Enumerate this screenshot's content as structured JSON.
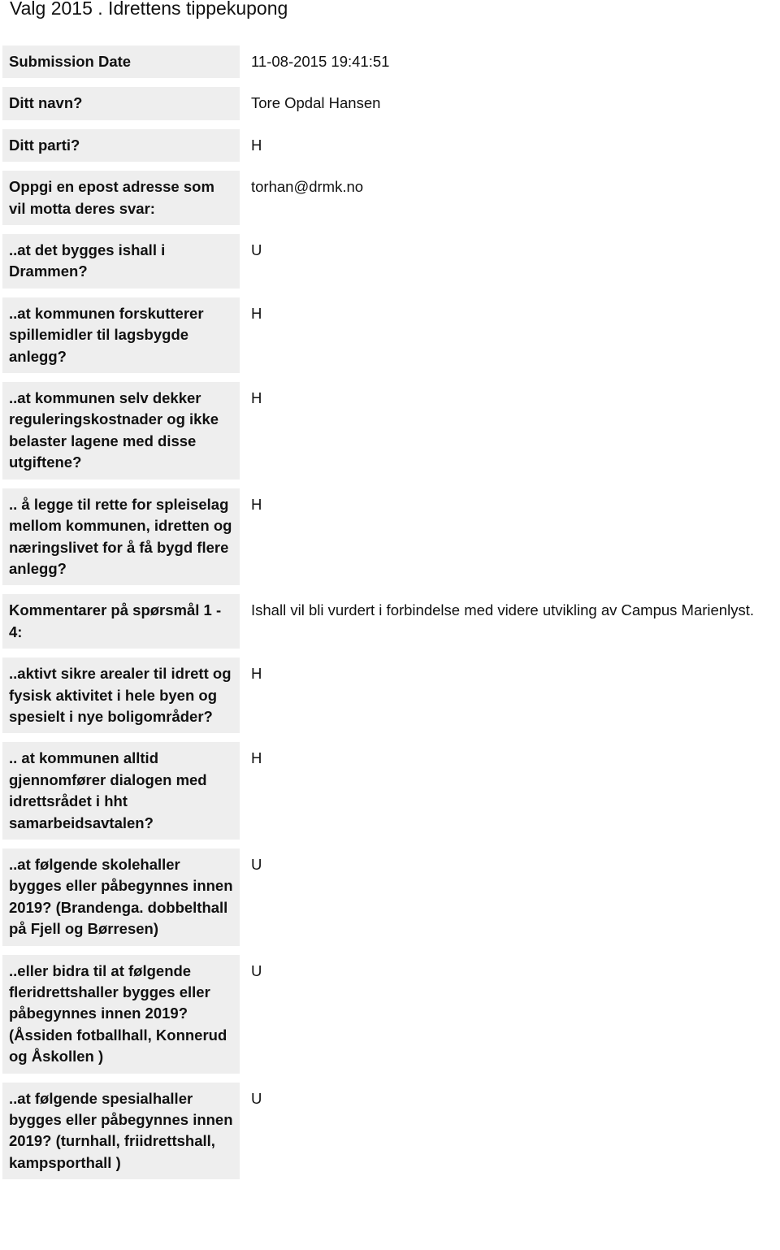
{
  "header": {
    "title": "Valg 2015 . Idrettens tippekupong"
  },
  "rows": [
    {
      "label": "Submission Date",
      "value": "11-08-2015 19:41:51"
    },
    {
      "label": "Ditt navn?",
      "value": "Tore Opdal Hansen"
    },
    {
      "label": "Ditt parti?",
      "value": "H"
    },
    {
      "label": "Oppgi en epost adresse som vil motta deres svar:",
      "value": "torhan@drmk.no"
    },
    {
      "label": "..at det bygges ishall i Drammen?",
      "value": "U"
    },
    {
      "label": "..at kommunen forskutterer spillemidler til lagsbygde anlegg?",
      "value": "H"
    },
    {
      "label": "..at kommunen selv dekker reguleringskostnader og ikke belaster lagene med disse utgiftene?",
      "value": "H"
    },
    {
      "label": ".. å legge til rette for spleiselag mellom kommunen, idretten og næringslivet for å få bygd flere anlegg?",
      "value": "H"
    },
    {
      "label": "Kommentarer på spørsmål 1 - 4:",
      "value": "Ishall vil bli vurdert i forbindelse med videre utvikling av Campus Marienlyst."
    },
    {
      "label": "..aktivt sikre arealer til idrett og fysisk aktivitet i hele byen og spesielt i nye boligområder?",
      "value": "H"
    },
    {
      "label": ".. at kommunen alltid gjennomfører dialogen med idrettsrådet i hht samarbeidsavtalen?",
      "value": "H"
    },
    {
      "label": "..at følgende skolehaller bygges eller påbegynnes innen 2019? (Brandenga. dobbelthall på Fjell og Børresen)",
      "value": "U"
    },
    {
      "label": "..eller bidra til at følgende fleridrettshaller bygges eller påbegynnes innen 2019? (Åssiden fotballhall, Konnerud og Åskollen )",
      "value": "U"
    },
    {
      "label": "..at følgende spesialhaller bygges eller påbegynnes innen 2019? (turnhall, friidrettshall, kampsporthall )",
      "value": "U"
    }
  ]
}
